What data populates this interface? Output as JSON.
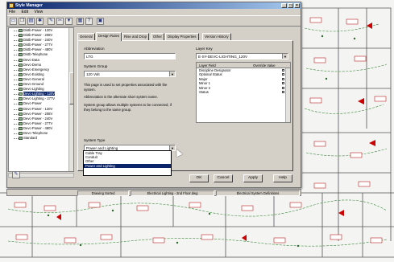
{
  "window": {
    "title": "Style Manager"
  },
  "menu": [
    "File",
    "Edit",
    "View"
  ],
  "tree_items": [
    "Distb-Power - 120V",
    "Distb-Power - 208V",
    "Distb-Power - 240V",
    "Distb-Power - 277V",
    "Distb-Power - 480V",
    "Distb-Telephone",
    "Devc-Data",
    "Devc-Demo",
    "Devc-Emergency",
    "Devc-Existing",
    "Devc-General",
    "Devc-Ground",
    "Devc-Lighting",
    "Devc-Lighting - 120V",
    "Devc-Lighting - 277V",
    "Devc-Power",
    "Devc-Power - 120V",
    "Devc-Power - 208V",
    "Devc-Power - 240V",
    "Devc-Power - 277V",
    "Devc-Power - 480V",
    "Devc-Telephone",
    "Standard"
  ],
  "selected_tree_index": 13,
  "tabs": [
    "General",
    "Design Rules",
    "Rise and Drop",
    "Other",
    "Display Properties",
    "Version History"
  ],
  "active_tab": 1,
  "form": {
    "abbreviation_label": "Abbreviation",
    "abbreviation_value": "LTG",
    "system_group_label": "System Group",
    "system_group_value": "120 Volt",
    "help_1": "This page is used to set properties associated with the system.",
    "help_2": "Abbreviation is the alternate short system name.",
    "help_3": "System group allows multiple systems to be connected, if they belong to the same group.",
    "system_type_label": "System Type",
    "system_type_value": "Power and Lighting",
    "layer_key_label": "Layer Key",
    "layer_key_value": "E-SY-DEVC-LIGHTING_120V"
  },
  "layer_table": {
    "headers": [
      "Layer Field",
      "Override Value"
    ],
    "rows": [
      "Discipline Designator",
      "Optional Status",
      "Major",
      "Minor 1",
      "Minor 2",
      "Status"
    ]
  },
  "system_type_options": [
    "Cable Tray",
    "Conduit",
    "Other",
    "Power and Lighting"
  ],
  "buttons": {
    "ok": "OK",
    "cancel": "Cancel",
    "apply": "Apply",
    "help": "Help"
  },
  "status": [
    "Drawing Sorted",
    "Electrical Lighting - 2nd Floor.dwg",
    "Electrical System Definitions"
  ],
  "colors": {
    "title_start": "#0a246a",
    "title_end": "#a6caf0",
    "selection": "#0a246a",
    "fixture": "#b22222"
  }
}
